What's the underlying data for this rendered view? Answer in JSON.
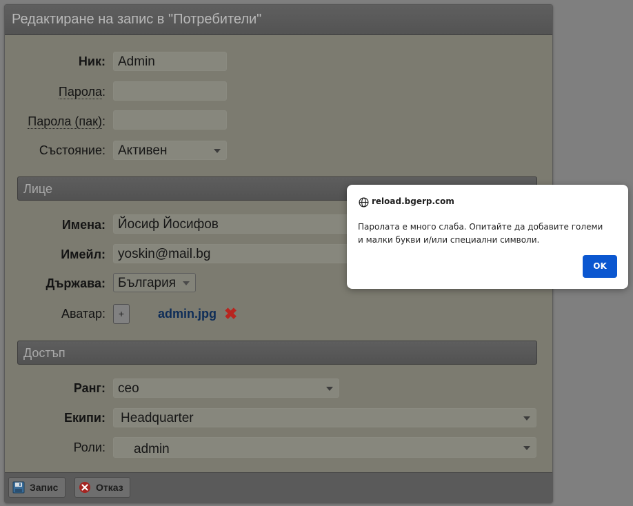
{
  "window": {
    "title": "Редактиране на запис в \"Потребители\""
  },
  "fields": {
    "nick": {
      "label": "Ник",
      "value": "Admin"
    },
    "password": {
      "label": "Парола",
      "value": ""
    },
    "password_again": {
      "label": "Парола (пак)",
      "value": ""
    },
    "state": {
      "label": "Състояние",
      "value": "Активен"
    },
    "names": {
      "label": "Имена",
      "value": "Йосиф Йосифов"
    },
    "email": {
      "label": "Имейл",
      "value": "yoskin@mail.bg"
    },
    "country": {
      "label": "Държава",
      "value": "България"
    },
    "avatar": {
      "label": "Аватар",
      "add_label": "+",
      "file": "admin.jpg"
    },
    "rank": {
      "label": "Ранг",
      "value": "ceo"
    },
    "teams": {
      "label": "Екипи",
      "value": "Headquarter"
    },
    "roles": {
      "label": "Роли",
      "value": "admin"
    }
  },
  "sections": {
    "person": "Лице",
    "access": "Достъп"
  },
  "footer": {
    "save": "Запис",
    "cancel": "Отказ"
  },
  "dialog": {
    "origin": "reload.bgerp.com",
    "message": "Паролата е много слаба. Опитайте да добавите големи и малки букви и/или специални символи.",
    "ok": "OK"
  },
  "colors": {
    "accent": "#0b57d0",
    "delete": "#b8251f"
  }
}
